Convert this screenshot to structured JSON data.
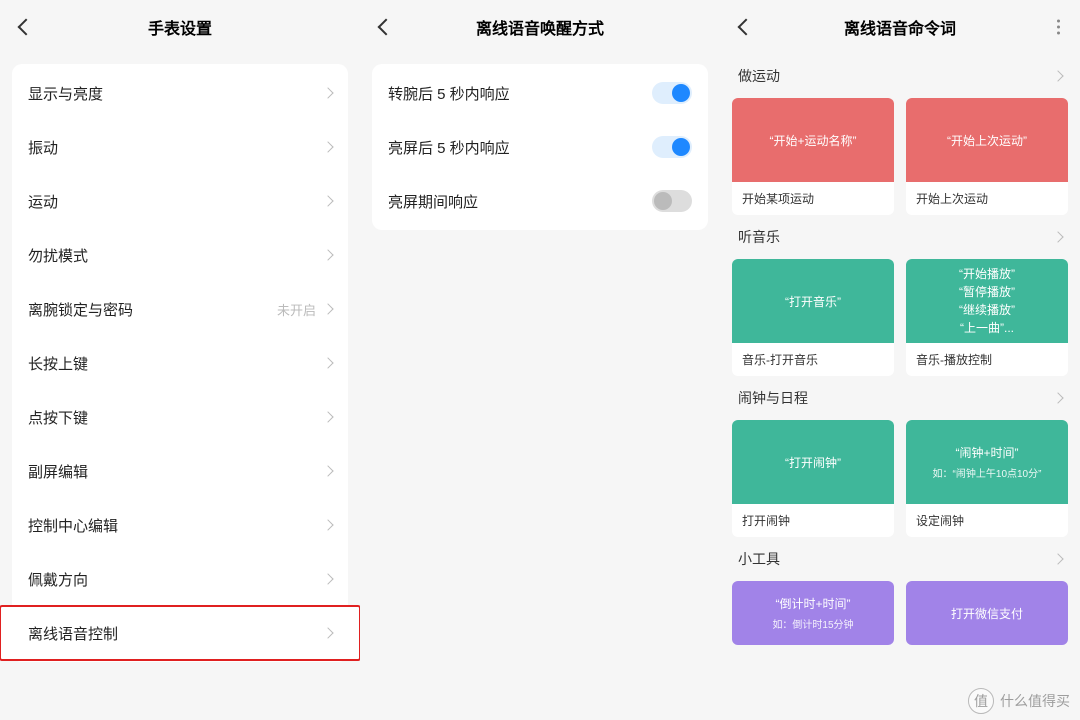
{
  "panel1": {
    "title": "手表设置",
    "items": [
      {
        "label": "显示与亮度"
      },
      {
        "label": "振动"
      },
      {
        "label": "运动"
      },
      {
        "label": "勿扰模式"
      },
      {
        "label": "离腕锁定与密码",
        "status": "未开启"
      },
      {
        "label": "长按上键"
      },
      {
        "label": "点按下键"
      },
      {
        "label": "副屏编辑"
      },
      {
        "label": "控制中心编辑"
      },
      {
        "label": "佩戴方向"
      },
      {
        "label": "离线语音控制",
        "highlighted": true
      }
    ]
  },
  "panel2": {
    "title": "离线语音唤醒方式",
    "items": [
      {
        "label": "转腕后 5 秒内响应",
        "on": true
      },
      {
        "label": "亮屏后 5 秒内响应",
        "on": true
      },
      {
        "label": "亮屏期间响应",
        "on": false
      }
    ]
  },
  "panel3": {
    "title": "离线语音命令词",
    "sections": [
      {
        "title": "做运动",
        "color": "coral",
        "cards": [
          {
            "main": "“开始+运动名称”",
            "caption": "开始某项运动"
          },
          {
            "main": "“开始上次运动”",
            "caption": "开始上次运动"
          }
        ]
      },
      {
        "title": "听音乐",
        "color": "teal",
        "cards": [
          {
            "main": "“打开音乐”",
            "caption": "音乐-打开音乐"
          },
          {
            "lines": [
              "“开始播放”",
              "“暂停播放”",
              "“继续播放”",
              "“上一曲”..."
            ],
            "caption": "音乐-播放控制"
          }
        ]
      },
      {
        "title": "闹钟与日程",
        "color": "teal",
        "cards": [
          {
            "main": "“打开闹钟”",
            "caption": "打开闹钟"
          },
          {
            "main": "“闹钟+时间”",
            "sub": "如：“闹钟上午10点10分”",
            "caption": "设定闹钟"
          }
        ]
      },
      {
        "title": "小工具",
        "color": "purple",
        "cards": [
          {
            "main": "“倒计时+时间”",
            "sub": "如：倒计时15分钟",
            "caption": ""
          },
          {
            "main": "打开微信支付",
            "caption": ""
          }
        ]
      }
    ]
  },
  "watermark": {
    "icon": "值",
    "text": "什么值得买"
  }
}
